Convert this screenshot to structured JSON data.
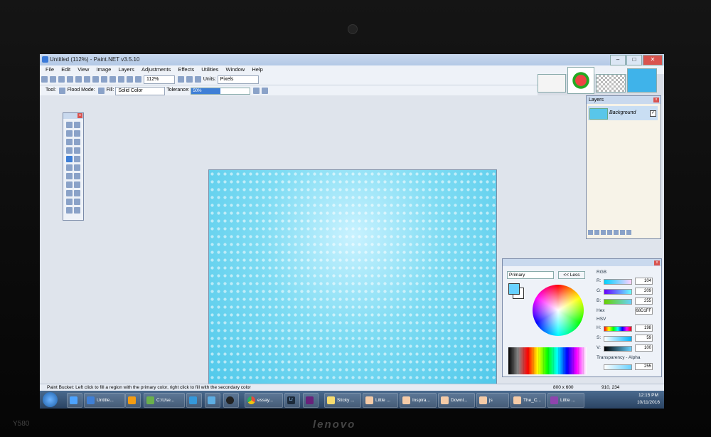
{
  "window": {
    "title": "Untitled (112%) - Paint.NET v3.5.10"
  },
  "menu": [
    "File",
    "Edit",
    "View",
    "Image",
    "Layers",
    "Adjustments",
    "Effects",
    "Utilities",
    "Window",
    "Help"
  ],
  "toolbar": {
    "zoom": "112%",
    "units_label": "Units:",
    "units_value": "Pixels"
  },
  "toolbar2": {
    "tool_label": "Tool:",
    "flood_label": "Flood Mode:",
    "fill_label": "Fill:",
    "fill_value": "Solid Color",
    "tolerance_label": "Tolerance:",
    "tolerance_value": "50%",
    "tolerance_fraction": 0.5
  },
  "layers": {
    "title": "Layers",
    "items": [
      {
        "name": "Background",
        "visible": "✓"
      }
    ]
  },
  "colors": {
    "mode": "Primary",
    "less_button": "<< Less",
    "rgb_label": "RGB",
    "r_label": "R:",
    "r": "104",
    "g_label": "G:",
    "g": "209",
    "b_label": "B:",
    "b": "255",
    "hex_label": "Hex",
    "hex": "68D1FF",
    "hsv_label": "HSV",
    "h_label": "H:",
    "h": "198",
    "s_label": "S:",
    "s": "59",
    "v_label": "V:",
    "v": "100",
    "alpha_label": "Transparency - Alpha",
    "alpha": "255",
    "primary_color": "#68d1ff",
    "secondary_color": "#ffffff"
  },
  "status": {
    "message": "Paint Bucket: Left click to fill a region with the primary color, right click to fill with the secondary color",
    "size": "800 x 600",
    "position": "910, 234"
  },
  "taskbar": {
    "items": [
      "Untitle...",
      "C:\\Use...",
      "essay...",
      "Sticky ...",
      "Little ...",
      "Inspira...",
      "Downl...",
      "js",
      "The_C...",
      "Little ..."
    ],
    "time": "12:15 PM",
    "date": "10/11/2016"
  },
  "device": {
    "brand": "lenovo"
  }
}
